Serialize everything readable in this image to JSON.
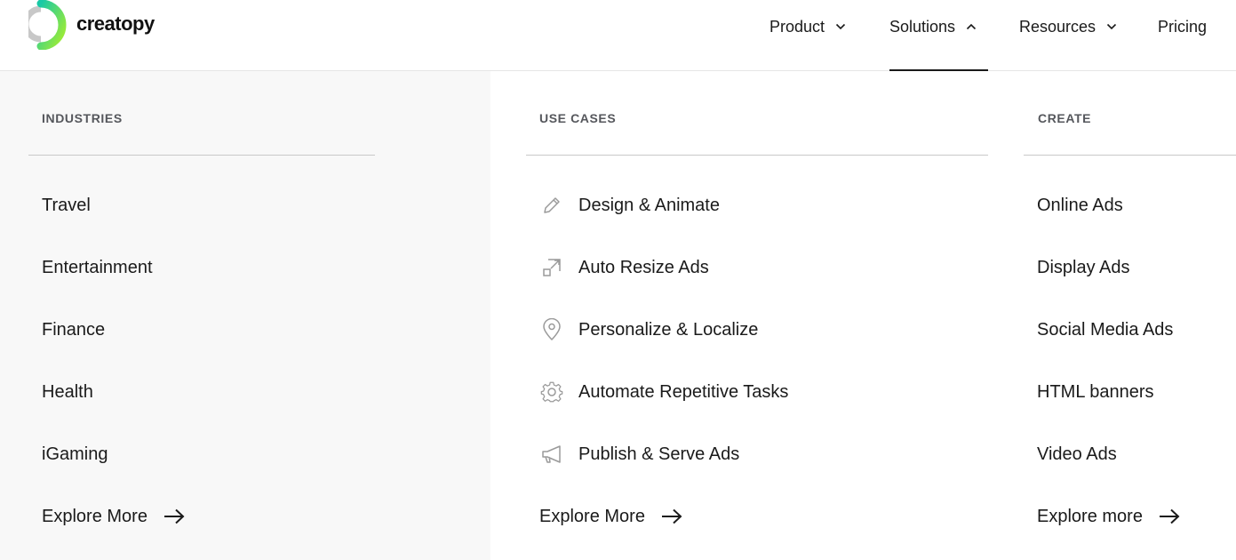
{
  "header": {
    "logo_text": "creatopy",
    "nav": [
      {
        "label": "Product",
        "icon": "chevron-down-icon"
      },
      {
        "label": "Solutions",
        "icon": "chevron-up-icon"
      },
      {
        "label": "Resources",
        "icon": "chevron-down-icon"
      },
      {
        "label": "Pricing"
      }
    ]
  },
  "industries": {
    "title": "INDUSTRIES",
    "items": [
      "Travel",
      "Entertainment",
      "Finance",
      "Health",
      "iGaming"
    ],
    "explore": "Explore More"
  },
  "use_cases": {
    "title": "USE CASES",
    "items": [
      {
        "label": "Design & Animate",
        "icon": "pencil-icon"
      },
      {
        "label": "Auto Resize Ads",
        "icon": "resize-icon"
      },
      {
        "label": "Personalize & Localize",
        "icon": "location-pin-icon"
      },
      {
        "label": "Automate Repetitive Tasks",
        "icon": "gear-icon"
      },
      {
        "label": "Publish & Serve Ads",
        "icon": "megaphone-icon"
      }
    ],
    "explore": "Explore More"
  },
  "create": {
    "title": "CREATE",
    "items": [
      "Online Ads",
      "Display Ads",
      "Social Media Ads",
      "HTML banners",
      "Video Ads"
    ],
    "explore": "Explore more"
  },
  "colors": {
    "accent_green": "#7ee02a",
    "accent_teal": "#19c9a6",
    "logo_gray": "#c8c8c8",
    "left_panel_bg": "#f8f8f8",
    "text": "#1a1a1a",
    "section_title": "#55575c"
  }
}
